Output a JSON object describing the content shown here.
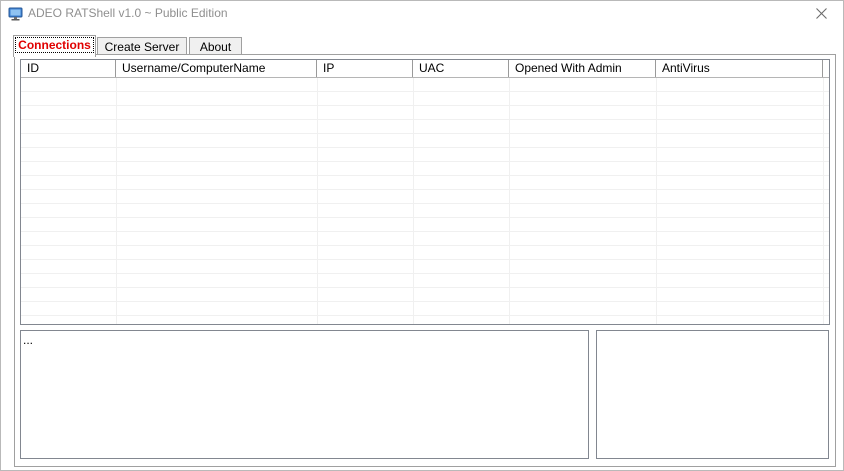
{
  "window": {
    "title": "ADEO RATShell v1.0 ~ Public Edition"
  },
  "icons": {
    "app": "computer-monitor-icon",
    "close": "close-icon"
  },
  "tabs": [
    {
      "label": "Connections",
      "active": true
    },
    {
      "label": "Create Server",
      "active": false
    },
    {
      "label": "About",
      "active": false
    }
  ],
  "connections_table": {
    "columns": [
      "ID",
      "Username/ComputerName",
      "IP",
      "UAC",
      "Opened With Admin",
      "AntiVirus"
    ],
    "rows": []
  },
  "log": {
    "text": "..."
  },
  "colors": {
    "active_tab_text": "#e00000",
    "title_text": "#8f8f8f",
    "border": "#a0a0a0"
  }
}
